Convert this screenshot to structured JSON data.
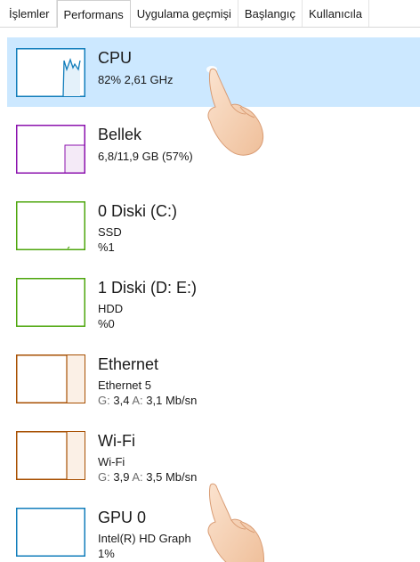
{
  "tabs": [
    {
      "label": "İşlemler",
      "active": false
    },
    {
      "label": "Performans",
      "active": true
    },
    {
      "label": "Uygulama geçmişi",
      "active": false
    },
    {
      "label": "Başlangıç",
      "active": false
    },
    {
      "label": "Kullanıcıla",
      "active": false
    }
  ],
  "items": [
    {
      "title": "CPU",
      "line1": "82% 2,61 GHz",
      "color": "#117dbb",
      "selected": true
    },
    {
      "title": "Bellek",
      "line1": "6,8/11,9 GB (57%)",
      "color": "#8b12ae",
      "usage_percent": 57
    },
    {
      "title": "0 Diski (C:)",
      "line1": "SSD",
      "line2": "%1",
      "color": "#4da60c"
    },
    {
      "title": "1 Diski (D: E:)",
      "line1": "HDD",
      "line2": "%0",
      "color": "#4da60c"
    },
    {
      "title": "Ethernet",
      "line1": "Ethernet 5",
      "send_label": "G:",
      "send_value": "3,4",
      "recv_label": "A:",
      "recv_value": "3,1 Mb/sn",
      "color": "#a74f01"
    },
    {
      "title": "Wi-Fi",
      "line1": "Wi-Fi",
      "send_label": "G:",
      "send_value": "3,9",
      "recv_label": "A:",
      "recv_value": "3,5 Mb/sn",
      "color": "#a74f01"
    },
    {
      "title": "GPU 0",
      "line1": "Intel(R) HD Graph",
      "line2": "1%",
      "color": "#117dbb"
    }
  ],
  "colors": {
    "selected_bg": "#cce8ff",
    "cpu": "#117dbb",
    "memory": "#8b12ae",
    "disk": "#4da60c",
    "network": "#a74f01",
    "gpu": "#117dbb"
  }
}
